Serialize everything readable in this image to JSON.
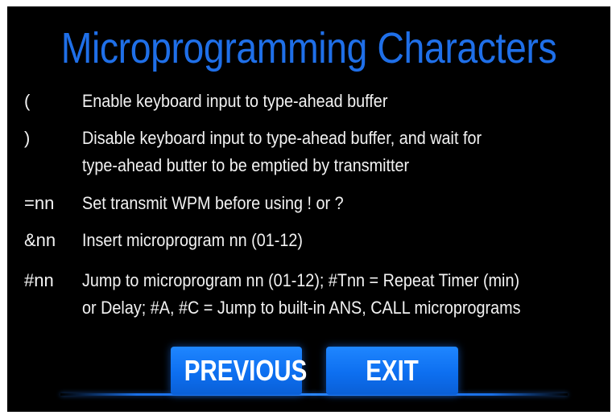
{
  "title": "Microprogramming Characters",
  "items": [
    {
      "key": "(",
      "lines": [
        "Enable keyboard input to type-ahead buffer"
      ]
    },
    {
      "key": ")",
      "lines": [
        "Disable keyboard input to type-ahead buffer, and wait for",
        "type-ahead butter to be emptied by transmitter"
      ]
    },
    {
      "key": "=nn",
      "lines": [
        "Set transmit WPM before using ! or ?"
      ]
    },
    {
      "key": "&nn",
      "lines": [
        "Insert microprogram nn (01-12)"
      ]
    },
    {
      "key": "#nn",
      "lines": [
        "Jump to microprogram nn (01-12); #Tnn = Repeat Timer (min)",
        "or Delay; #A, #C = Jump to built-in ANS, CALL microprograms"
      ]
    }
  ],
  "buttons": {
    "previous_label": "PREVIOUS",
    "exit_label": "EXIT"
  },
  "colors": {
    "title": "#1f6fe8",
    "button": "#0d6ff0",
    "background": "#000000",
    "text": "#f2f2f2"
  }
}
